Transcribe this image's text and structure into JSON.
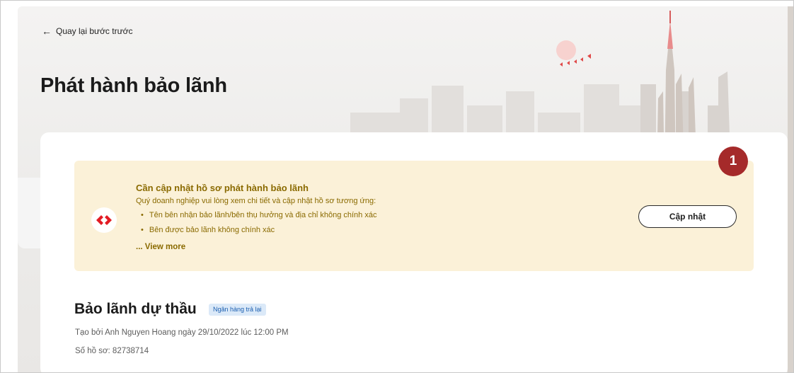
{
  "header": {
    "back_label": "Quay lại bước trước",
    "page_title": "Phát hành bảo lãnh"
  },
  "notice": {
    "title": "Cần cập nhật hồ sơ phát hành bảo lãnh",
    "description": "Quý doanh nghiệp vui lòng xem chi tiết và cập nhật hồ sơ tương ứng:",
    "items": [
      "Tên bên nhận bảo lãnh/bên thụ hưởng và địa chỉ không chính xác",
      "Bên được bảo lãnh không chính xác"
    ],
    "view_more": "... View more",
    "update_button": "Cập nhật",
    "icon": "bank-logo-icon",
    "accent_color": "#fbf1d8",
    "text_color": "#8a6a00"
  },
  "marker": {
    "label": "1",
    "color": "#a52a2a"
  },
  "guarantee": {
    "title": "Bảo lãnh dự thầu",
    "status": "Ngân hàng trả lại",
    "created": "Tạo bởi Anh Nguyen Hoang ngày 29/10/2022 lúc 12:00 PM",
    "record_number": "Số hồ sơ: 82738714"
  }
}
